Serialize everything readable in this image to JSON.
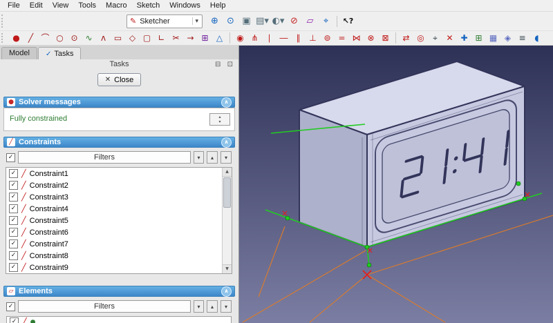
{
  "menubar": {
    "items": [
      "File",
      "Edit",
      "View",
      "Tools",
      "Macro",
      "Sketch",
      "Windows",
      "Help"
    ]
  },
  "toolbars": {
    "workbench_selector": {
      "label": "Sketcher",
      "icon_glyph": "✎"
    },
    "whats_this_glyph": "↖?",
    "view_icons": [
      {
        "name": "fit-all-icon",
        "glyph": "⊕",
        "color": "#1565c0"
      },
      {
        "name": "fit-selection-icon",
        "glyph": "⊙",
        "color": "#1565c0"
      },
      {
        "name": "axonometric-view-icon",
        "glyph": "▣",
        "color": "#546e7a"
      },
      {
        "name": "view-select-icon",
        "glyph": "▤▾",
        "color": "#546e7a"
      },
      {
        "name": "draw-style-icon",
        "glyph": "◐▾",
        "color": "#546e7a"
      },
      {
        "name": "stop-operation-icon",
        "glyph": "⊘",
        "color": "#c62828"
      },
      {
        "name": "view-sketch-icon",
        "glyph": "▱",
        "color": "#8e24aa"
      },
      {
        "name": "zoom-measure-icon",
        "glyph": "⌖",
        "color": "#1565c0"
      }
    ],
    "sketch_geometry_icons": [
      {
        "name": "create-point-icon",
        "glyph": "●",
        "color": "#c01818"
      },
      {
        "name": "create-line-icon",
        "glyph": "╱",
        "color": "#a01818"
      },
      {
        "name": "create-arc-icon",
        "glyph": "⌒",
        "color": "#a01818"
      },
      {
        "name": "create-circle-icon",
        "glyph": "○",
        "color": "#a01818"
      },
      {
        "name": "create-conic-icon",
        "glyph": "⊙",
        "color": "#a01818"
      },
      {
        "name": "create-bspline-icon",
        "glyph": "∿",
        "color": "#2e7d32"
      },
      {
        "name": "create-polyline-icon",
        "glyph": "ʌ",
        "color": "#a01818"
      },
      {
        "name": "create-rectangle-icon",
        "glyph": "▭",
        "color": "#a01818"
      },
      {
        "name": "create-polygon-icon",
        "glyph": "◇",
        "color": "#a01818"
      },
      {
        "name": "create-slot-icon",
        "glyph": "▢",
        "color": "#a01818"
      },
      {
        "name": "create-fillet-icon",
        "glyph": "∟",
        "color": "#a01818"
      },
      {
        "name": "trim-edge-icon",
        "glyph": "✂",
        "color": "#a01818"
      },
      {
        "name": "extend-edge-icon",
        "glyph": "→",
        "color": "#a01818"
      },
      {
        "name": "external-geometry-icon",
        "glyph": "⊞",
        "color": "#6a1b9a"
      },
      {
        "name": "construction-mode-icon",
        "glyph": "△",
        "color": "#1565c0"
      }
    ],
    "sketch_constraint_icons": [
      {
        "name": "constrain-coincident-icon",
        "glyph": "◉",
        "color": "#c01818"
      },
      {
        "name": "constrain-point-on-object-icon",
        "glyph": "⋔",
        "color": "#c01818"
      },
      {
        "name": "constrain-vertical-icon",
        "glyph": "∣",
        "color": "#c01818"
      },
      {
        "name": "constrain-horizontal-icon",
        "glyph": "―",
        "color": "#c01818"
      },
      {
        "name": "constrain-parallel-icon",
        "glyph": "∥",
        "color": "#c01818"
      },
      {
        "name": "constrain-perpendicular-icon",
        "glyph": "⊥",
        "color": "#c01818"
      },
      {
        "name": "constrain-tangent-icon",
        "glyph": "⊚",
        "color": "#c01818"
      },
      {
        "name": "constrain-equal-icon",
        "glyph": "=",
        "color": "#c01818"
      },
      {
        "name": "constrain-symmetric-icon",
        "glyph": "⋈",
        "color": "#c01818"
      },
      {
        "name": "constrain-block-icon",
        "glyph": "⊗",
        "color": "#c01818"
      },
      {
        "name": "constrain-lock-icon",
        "glyph": "⊠",
        "color": "#c01818"
      }
    ],
    "sketch_tool_icons": [
      {
        "name": "toggle-driving-constraint-icon",
        "glyph": "⇄",
        "color": "#c01818"
      },
      {
        "name": "activate-constraint-icon",
        "glyph": "◎",
        "color": "#c01818"
      },
      {
        "name": "select-origin-icon",
        "glyph": "⌖",
        "color": "#37474f"
      },
      {
        "name": "remove-axes-alignment-icon",
        "glyph": "✕",
        "color": "#c01818"
      },
      {
        "name": "clone-geometry-icon",
        "glyph": "✚",
        "color": "#1565c0"
      },
      {
        "name": "copy-geometry-icon",
        "glyph": "⊞",
        "color": "#2e7d32"
      },
      {
        "name": "grid-toggle-icon",
        "glyph": "▦",
        "color": "#5c6bc0"
      },
      {
        "name": "snap-toggle-icon",
        "glyph": "◈",
        "color": "#5c6bc0"
      },
      {
        "name": "rendering-order-icon",
        "glyph": "≡",
        "color": "#37474f"
      },
      {
        "name": "virtual-space-icon",
        "glyph": "◖",
        "color": "#1565c0"
      }
    ]
  },
  "tabs": {
    "model": "Model",
    "tasks": "Tasks"
  },
  "tasks_panel": {
    "title": "Tasks",
    "close_label": "Close",
    "solver": {
      "title": "Solver messages",
      "message": "Fully constrained"
    },
    "constraints": {
      "title": "Constraints",
      "filter_label": "Filters",
      "items": [
        "Constraint1",
        "Constraint2",
        "Constraint3",
        "Constraint4",
        "Constraint5",
        "Constraint6",
        "Constraint7",
        "Constraint8",
        "Constraint9"
      ]
    },
    "elements": {
      "title": "Elements",
      "filter_label": "Filters"
    }
  },
  "viewport": {
    "model": {
      "display_text": "21:41"
    }
  },
  "ui": {
    "glyphs": {
      "check": "✓",
      "dropdown": "▾",
      "up": "▴",
      "down": "▾",
      "scroll_up": "▲",
      "scroll_down": "▼",
      "collapse": "∧",
      "close": "✕",
      "constraint": "╱",
      "dock": "⊟",
      "float": "⊡",
      "tasks_tab": "✓",
      "header_solver": "●",
      "header_constraints": "╱",
      "header_elements": "▱",
      "element_edge": "╱",
      "element_point": "●"
    }
  },
  "colors": {
    "vp-top": "#2e3156",
    "vp-bottom": "#7b7ea2",
    "hdr-top": "#64b0e4",
    "hdr-bottom": "#3d87c9",
    "face-front": "#c6c9e0",
    "face-top": "#d7d9ec",
    "face-left": "#aeb1cb",
    "edge": "#33345a",
    "sketch-green": "#21cc21",
    "dim-orange": "#e07b28",
    "origin-red": "#e02020",
    "msg-green": "#2e7d32"
  }
}
